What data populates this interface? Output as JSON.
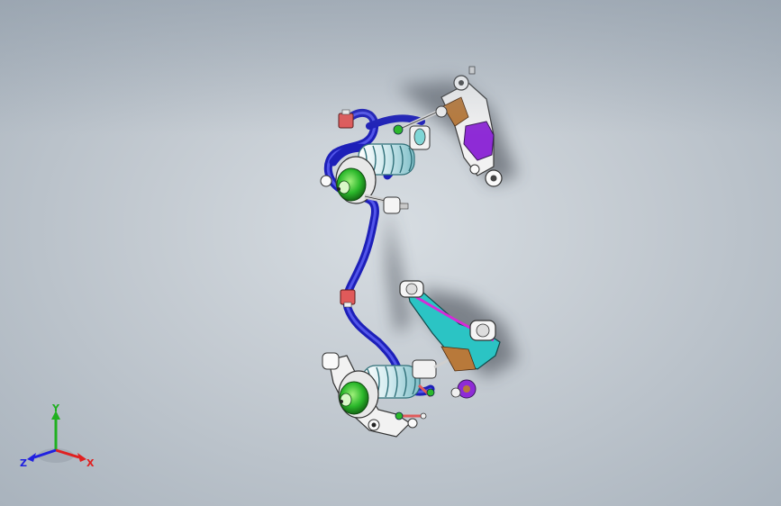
{
  "viewport": {
    "background_top": "#8f9bab",
    "background_center": "#d7dde2",
    "background_bottom": "#a9b3bd"
  },
  "model": {
    "stabilizer_bar_color": "#1d1fb8",
    "upper_arm_rear_color": "#8e2bd6",
    "lower_arm_color": "#2bc4c4",
    "lower_arm_accent_color": "#d62bd6",
    "hub_color": "#2bb82b",
    "spring_color": "#7fd6d6",
    "bushing_color": "#e05a5a",
    "knuckle_color": "#b8793a"
  },
  "triad": {
    "x_label": "X",
    "y_label": "Y",
    "z_label": "Z",
    "x_color": "#e02020",
    "y_color": "#20b020",
    "z_color": "#2020e0"
  }
}
